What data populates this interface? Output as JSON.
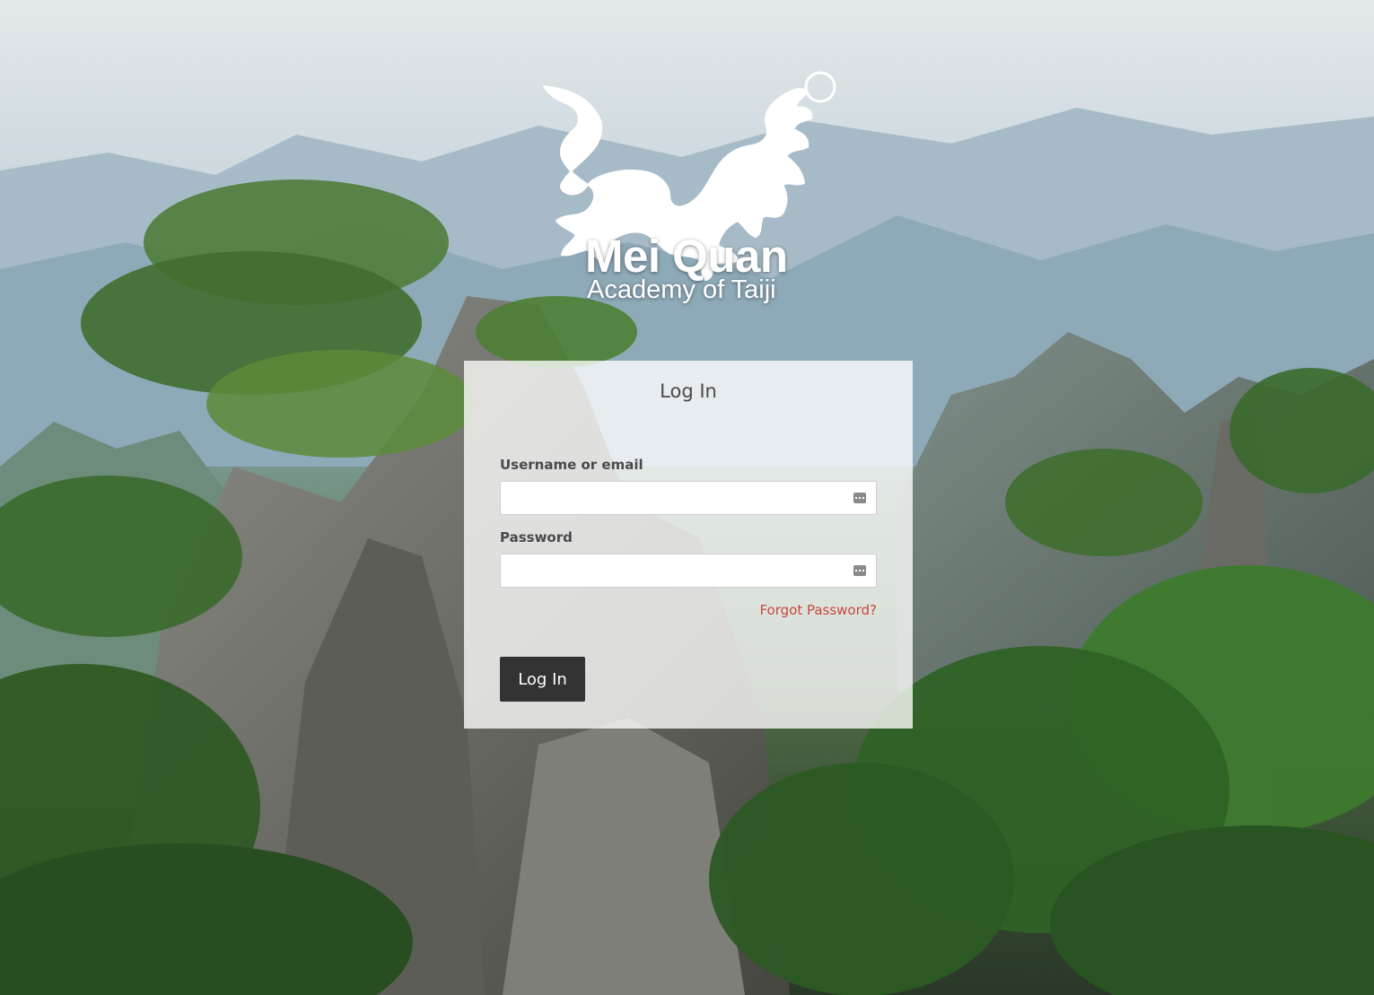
{
  "brand": {
    "title": "Mei Quan",
    "subtitle": "Academy of Taiji"
  },
  "login_card": {
    "heading": "Log In",
    "username": {
      "label": "Username or email",
      "value": "",
      "autofill_icon": "autofill-key-icon"
    },
    "password": {
      "label": "Password",
      "value": "",
      "autofill_icon": "autofill-key-icon"
    },
    "forgot_password": "Forgot Password?",
    "submit_label": "Log In"
  },
  "colors": {
    "card_background": "#ffffff",
    "button_background": "#333333",
    "button_text": "#ffffff",
    "link": "#c9483d",
    "label": "#4a4a4a"
  }
}
